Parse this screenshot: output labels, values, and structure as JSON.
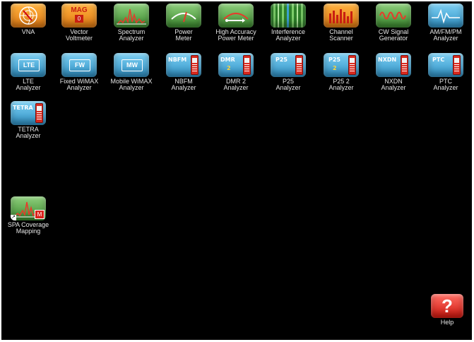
{
  "apps": {
    "vna": "VNA",
    "vector_voltmeter": "Vector\nVoltmeter",
    "spectrum_analyzer": "Spectrum\nAnalyzer",
    "power_meter": "Power\nMeter",
    "high_accuracy_power_meter": "High Accuracy\nPower Meter",
    "interference_analyzer": "Interference\nAnalyzer",
    "channel_scanner": "Channel\nScanner",
    "cw_signal_generator": "CW Signal\nGenerator",
    "am_fm_pm_analyzer": "AM/FM/PM\nAnalyzer",
    "lte_analyzer": "LTE\nAnalyzer",
    "fixed_wimax_analyzer": "Fixed WiMAX\nAnalyzer",
    "mobile_wimax_analyzer": "Mobile WiMAX\nAnalyzer",
    "nbfm_analyzer": "NBFM\nAnalyzer",
    "dmr2_analyzer": "DMR 2\nAnalyzer",
    "p25_analyzer": "P25\nAnalyzer",
    "p25_2_analyzer": "P25 2\nAnalyzer",
    "nxdn_analyzer": "NXDN\nAnalyzer",
    "ptc_analyzer": "PTC\nAnalyzer",
    "tetra_analyzer": "TETRA\nAnalyzer",
    "spa_coverage_mapping": "SPA Coverage\nMapping",
    "help": "Help"
  },
  "icon_text": {
    "mag": "MAG",
    "mag_num": "0",
    "lte": "LTE",
    "fw": "FW",
    "mw": "MW",
    "nbfm": "NBFM",
    "dmr": "DMR",
    "dmr_num": "2",
    "p25": "P25",
    "p25_2": "P25",
    "p25_2_num": "2",
    "nxdn": "NXDN",
    "ptc": "PTC",
    "tetra": "TETRA",
    "m": "M",
    "help_q": "?"
  },
  "colors": {
    "background": "#000000",
    "orange_tile": "#e47b12",
    "green_tile": "#3b8a2e",
    "blue_tile": "#2f93c8",
    "help_tile": "#d0160d"
  }
}
